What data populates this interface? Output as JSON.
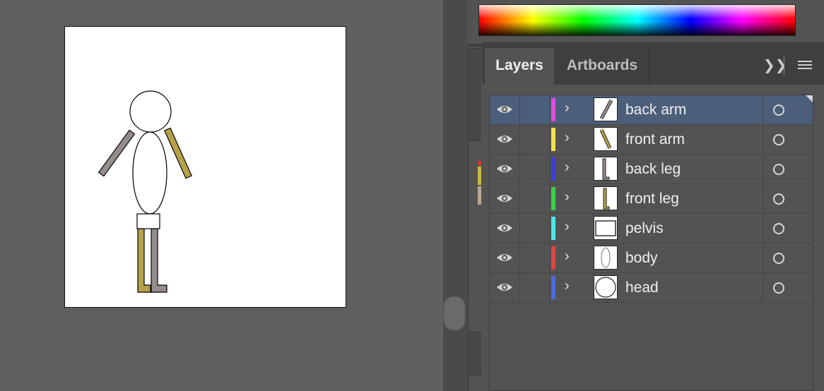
{
  "workspace": {
    "artboard": "figure-drawing"
  },
  "colors": {
    "figure_outline": "#000000",
    "back_limb_fill": "#958c8c",
    "front_limb_fill": "#b6a04a",
    "panel_bg": "#535353",
    "selected_row": "#4b5e7a"
  },
  "layers_panel": {
    "tabs": [
      {
        "label": "Layers",
        "active": true
      },
      {
        "label": "Artboards",
        "active": false
      }
    ],
    "expand_icon": "double-chevron-right-icon",
    "menu_icon": "hamburger-menu-icon",
    "layers": [
      {
        "name": "back arm",
        "color": "#e04ce0",
        "visible": true,
        "selected": true,
        "thumbnail": "back-arm"
      },
      {
        "name": "front arm",
        "color": "#f2e24a",
        "visible": true,
        "selected": false,
        "thumbnail": "front-arm"
      },
      {
        "name": "back leg",
        "color": "#3e3ed8",
        "visible": true,
        "selected": false,
        "thumbnail": "back-leg"
      },
      {
        "name": "front leg",
        "color": "#3fcf4a",
        "visible": true,
        "selected": false,
        "thumbnail": "front-leg"
      },
      {
        "name": "pelvis",
        "color": "#4ae8e8",
        "visible": true,
        "selected": false,
        "thumbnail": "pelvis"
      },
      {
        "name": "body",
        "color": "#e04444",
        "visible": true,
        "selected": false,
        "thumbnail": "body"
      },
      {
        "name": "head",
        "color": "#4a6ee0",
        "visible": true,
        "selected": false,
        "thumbnail": "head"
      }
    ]
  }
}
